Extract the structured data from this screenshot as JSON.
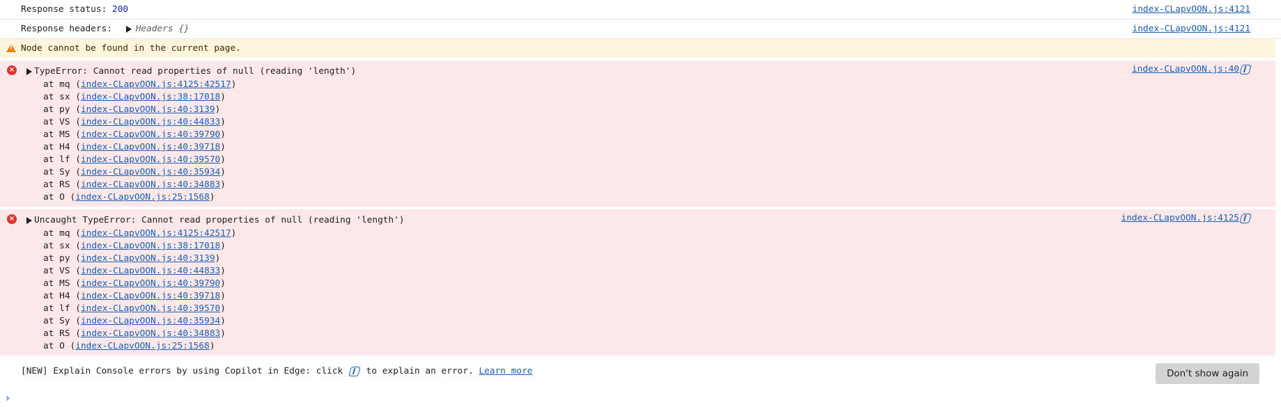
{
  "console": {
    "response_status": {
      "label": "Response status: ",
      "value": "200",
      "source": "index-CLapvOON.js:4121"
    },
    "response_headers": {
      "label": "Response headers: ",
      "toggle_label": "Headers {}",
      "source": "index-CLapvOON.js:4121"
    },
    "warning": {
      "text": "Node cannot be found in the current page."
    },
    "error1": {
      "message": "TypeError: Cannot read properties of null (reading 'length')",
      "source": "index-CLapvOON.js:40",
      "stack": [
        {
          "fn": "at mq (",
          "loc": "index-CLapvOON.js:4125:42517"
        },
        {
          "fn": "at sx (",
          "loc": "index-CLapvOON.js:38:17018"
        },
        {
          "fn": "at py (",
          "loc": "index-CLapvOON.js:40:3139"
        },
        {
          "fn": "at VS (",
          "loc": "index-CLapvOON.js:40:44833"
        },
        {
          "fn": "at MS (",
          "loc": "index-CLapvOON.js:40:39790"
        },
        {
          "fn": "at H4 (",
          "loc": "index-CLapvOON.js:40:39718"
        },
        {
          "fn": "at lf (",
          "loc": "index-CLapvOON.js:40:39570"
        },
        {
          "fn": "at Sy (",
          "loc": "index-CLapvOON.js:40:35934"
        },
        {
          "fn": "at RS (",
          "loc": "index-CLapvOON.js:40:34883"
        },
        {
          "fn": "at O (",
          "loc": "index-CLapvOON.js:25:1568"
        }
      ]
    },
    "error2": {
      "message": "Uncaught TypeError: Cannot read properties of null (reading 'length')",
      "source": "index-CLapvOON.js:4125",
      "stack": [
        {
          "fn": "at mq (",
          "loc": "index-CLapvOON.js:4125:42517"
        },
        {
          "fn": "at sx (",
          "loc": "index-CLapvOON.js:38:17018"
        },
        {
          "fn": "at py (",
          "loc": "index-CLapvOON.js:40:3139"
        },
        {
          "fn": "at VS (",
          "loc": "index-CLapvOON.js:40:44833"
        },
        {
          "fn": "at MS (",
          "loc": "index-CLapvOON.js:40:39790"
        },
        {
          "fn": "at H4 (",
          "loc": "index-CLapvOON.js:40:39718"
        },
        {
          "fn": "at lf (",
          "loc": "index-CLapvOON.js:40:39570"
        },
        {
          "fn": "at Sy (",
          "loc": "index-CLapvOON.js:40:35934"
        },
        {
          "fn": "at RS (",
          "loc": "index-CLapvOON.js:40:34883"
        },
        {
          "fn": "at O (",
          "loc": "index-CLapvOON.js:25:1568"
        }
      ]
    },
    "promo": {
      "text_before": "[NEW] Explain Console errors by using Copilot in Edge: click ",
      "text_after": " to explain an error. ",
      "learn_more": "Learn more",
      "dont_show": "Don't show again"
    },
    "prompt": {
      "chevron": "›"
    }
  },
  "icons": {
    "error": "error-icon",
    "warning": "warning-icon",
    "copilot": "copilot-icon",
    "expand": "triangle-right-icon"
  },
  "colors": {
    "error_bg": "#fce8e8",
    "warning_bg": "#fdf6dc",
    "link": "#1a5fb4",
    "error_icon": "#dc362e",
    "warning_icon": "#e8810c"
  }
}
